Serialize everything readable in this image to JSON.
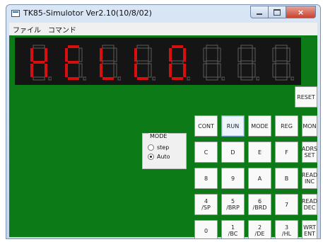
{
  "window": {
    "title": "TK85-Simulotor Ver2.10(10/8/02)",
    "minimize_symbol": "",
    "maximize_symbol": "",
    "close_symbol": "×"
  },
  "menu": [
    "ファイル",
    "コマンド"
  ],
  "display": {
    "digits": [
      "H",
      "E",
      "L",
      "L",
      "0",
      "",
      "",
      ""
    ],
    "lit_color": "#d70f0f",
    "unlit_color": "#5d5d5d"
  },
  "mode": {
    "legend": "MODE",
    "options": [
      "step",
      "Auto"
    ],
    "selected": "Auto"
  },
  "keys": {
    "reset": "RESET",
    "row1": [
      "CONT",
      "RUN",
      "MODE",
      "REG",
      "MON"
    ],
    "row2": [
      "C",
      "D",
      "E",
      "F",
      "ADRS\nSET"
    ],
    "row3": [
      "8",
      "9",
      "A",
      "B",
      "READ\nINC"
    ],
    "row4": [
      "4\n/SP",
      "5\n/BRP",
      "6\n/BRD",
      "7",
      "READ\nDEC"
    ],
    "row5": [
      "0",
      "1\n/BC",
      "2\n/DE",
      "3\n/HL",
      "WRT\nENT"
    ],
    "pressed": "RUN"
  },
  "colors": {
    "panel": "#0d7a18",
    "display_bg": "#151515"
  }
}
